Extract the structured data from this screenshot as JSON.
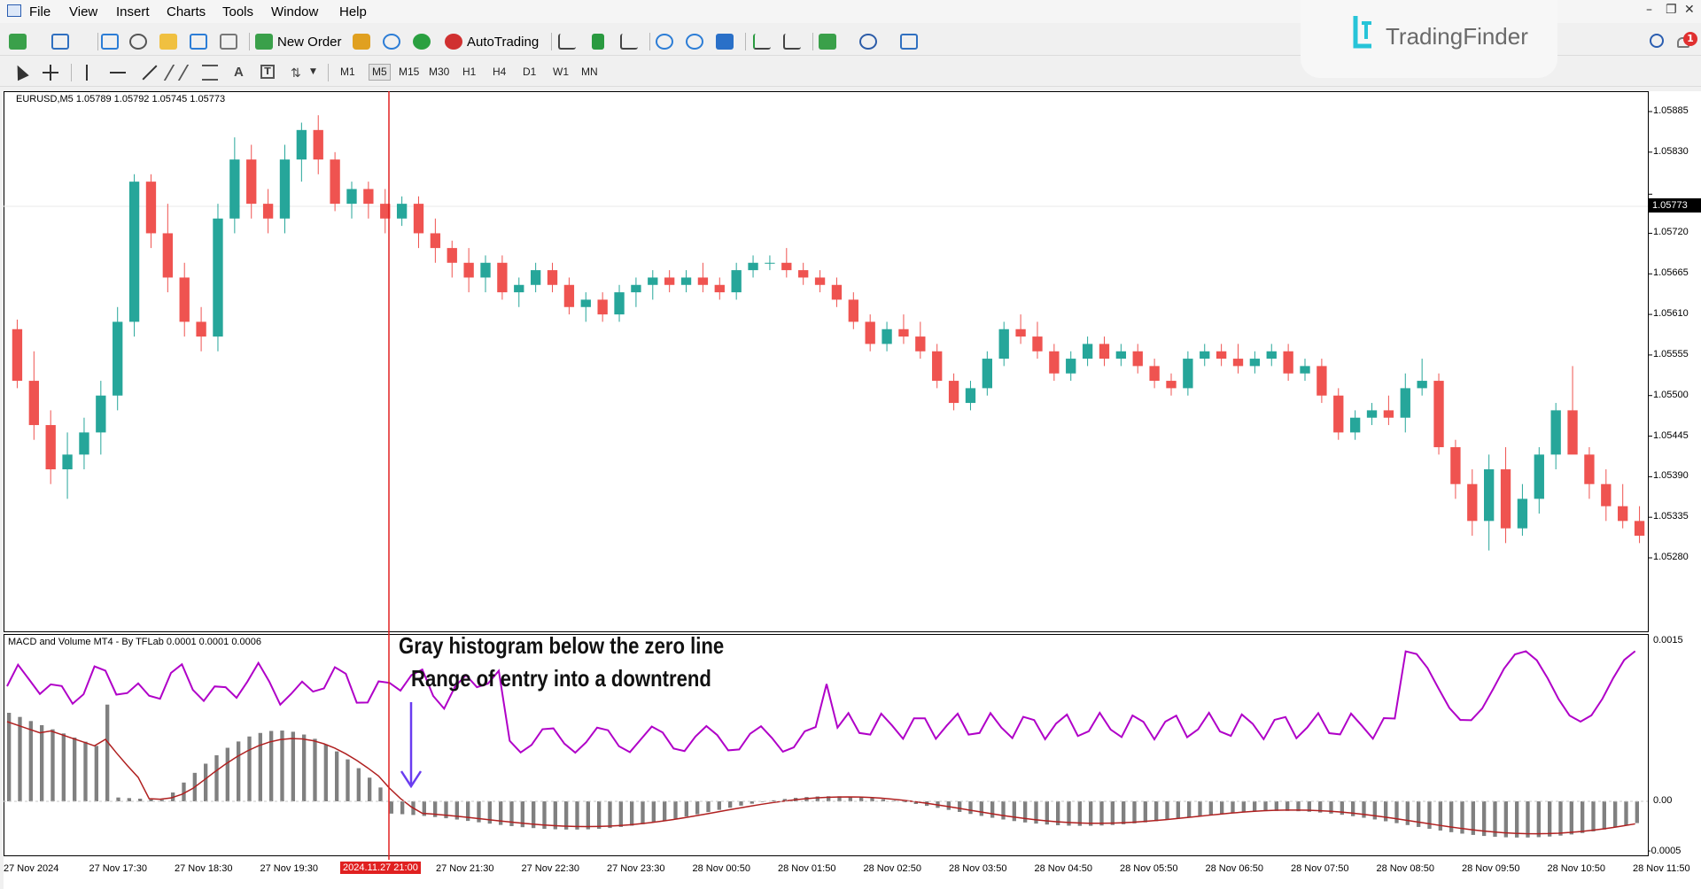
{
  "menu": [
    "File",
    "View",
    "Insert",
    "Charts",
    "Tools",
    "Window",
    "Help"
  ],
  "toolbar": {
    "new_order": "New Order",
    "autotrading": "AutoTrading"
  },
  "timeframes": [
    "M1",
    "M5",
    "M15",
    "M30",
    "H1",
    "H4",
    "D1",
    "W1",
    "MN"
  ],
  "active_timeframe": "M5",
  "logo": {
    "text": "TradingFinder"
  },
  "notification_count": "1",
  "chart": {
    "header": "EURUSD,M5  1.05789 1.05792 1.05745 1.05773",
    "price_labels": [
      "1.05885",
      "1.05830",
      "1.05773",
      "1.05720",
      "1.05665",
      "1.05610",
      "1.05555",
      "1.05500",
      "1.05445",
      "1.05390",
      "1.05335",
      "1.05280"
    ],
    "current_price": "1.05773",
    "bull_color": "#26a69a",
    "bear_color": "#ef5350",
    "line_color": "#e02020",
    "candles": [
      [
        1.0559,
        1.05603,
        1.0551,
        1.0552
      ],
      [
        1.0552,
        1.0556,
        1.0544,
        1.0546
      ],
      [
        1.0546,
        1.0548,
        1.0538,
        1.054
      ],
      [
        1.054,
        1.0545,
        1.0536,
        1.0542
      ],
      [
        1.0542,
        1.0547,
        1.054,
        1.0545
      ],
      [
        1.0545,
        1.0552,
        1.0542,
        1.055
      ],
      [
        1.055,
        1.0562,
        1.0548,
        1.056
      ],
      [
        1.056,
        1.058,
        1.0558,
        1.0579
      ],
      [
        1.0579,
        1.058,
        1.057,
        1.0572
      ],
      [
        1.0572,
        1.0576,
        1.0564,
        1.0566
      ],
      [
        1.0566,
        1.0568,
        1.0558,
        1.056
      ],
      [
        1.056,
        1.0562,
        1.0556,
        1.0558
      ],
      [
        1.0558,
        1.0576,
        1.0556,
        1.0574
      ],
      [
        1.0574,
        1.0585,
        1.0572,
        1.0582
      ],
      [
        1.0582,
        1.0584,
        1.0574,
        1.0576
      ],
      [
        1.0576,
        1.0578,
        1.0572,
        1.0574
      ],
      [
        1.0574,
        1.0584,
        1.0572,
        1.0582
      ],
      [
        1.0582,
        1.0587,
        1.0579,
        1.0586
      ],
      [
        1.0586,
        1.0588,
        1.058,
        1.0582
      ],
      [
        1.0582,
        1.0583,
        1.0575,
        1.0576
      ],
      [
        1.0576,
        1.0579,
        1.0574,
        1.0578
      ],
      [
        1.0578,
        1.0579,
        1.0574,
        1.0576
      ],
      [
        1.0576,
        1.0578,
        1.0572,
        1.0574
      ],
      [
        1.0574,
        1.0577,
        1.0573,
        1.0576
      ],
      [
        1.0576,
        1.0577,
        1.057,
        1.0572
      ],
      [
        1.0572,
        1.0574,
        1.0568,
        1.057
      ],
      [
        1.057,
        1.0571,
        1.0566,
        1.0568
      ],
      [
        1.0568,
        1.057,
        1.0564,
        1.0566
      ],
      [
        1.0566,
        1.0569,
        1.0564,
        1.0568
      ],
      [
        1.0568,
        1.0569,
        1.0563,
        1.0564
      ],
      [
        1.0564,
        1.0566,
        1.0562,
        1.0565
      ],
      [
        1.0565,
        1.0568,
        1.0564,
        1.0567
      ],
      [
        1.0567,
        1.0568,
        1.0564,
        1.0565
      ],
      [
        1.0565,
        1.0566,
        1.0561,
        1.0562
      ],
      [
        1.0562,
        1.0564,
        1.056,
        1.0563
      ],
      [
        1.0563,
        1.0564,
        1.056,
        1.0561
      ],
      [
        1.0561,
        1.0565,
        1.056,
        1.0564
      ],
      [
        1.0564,
        1.0566,
        1.0562,
        1.0565
      ],
      [
        1.0565,
        1.0567,
        1.0563,
        1.0566
      ],
      [
        1.0566,
        1.0567,
        1.0564,
        1.0565
      ],
      [
        1.0565,
        1.0567,
        1.0564,
        1.0566
      ],
      [
        1.0566,
        1.0568,
        1.0564,
        1.0565
      ],
      [
        1.0565,
        1.0566,
        1.0563,
        1.0564
      ],
      [
        1.0564,
        1.0568,
        1.0563,
        1.0567
      ],
      [
        1.0567,
        1.0569,
        1.0566,
        1.0568
      ],
      [
        1.0568,
        1.0569,
        1.0567,
        1.0568
      ],
      [
        1.0568,
        1.057,
        1.0566,
        1.0567
      ],
      [
        1.0567,
        1.0568,
        1.0565,
        1.0566
      ],
      [
        1.0566,
        1.0567,
        1.0564,
        1.0565
      ],
      [
        1.0565,
        1.0566,
        1.0562,
        1.0563
      ],
      [
        1.0563,
        1.0564,
        1.0559,
        1.056
      ],
      [
        1.056,
        1.0561,
        1.0556,
        1.0557
      ],
      [
        1.0557,
        1.056,
        1.0556,
        1.0559
      ],
      [
        1.0559,
        1.0561,
        1.0557,
        1.0558
      ],
      [
        1.0558,
        1.056,
        1.0555,
        1.0556
      ],
      [
        1.0556,
        1.0557,
        1.0551,
        1.0552
      ],
      [
        1.0552,
        1.0553,
        1.0548,
        1.0549
      ],
      [
        1.0549,
        1.0552,
        1.0548,
        1.0551
      ],
      [
        1.0551,
        1.0556,
        1.055,
        1.0555
      ],
      [
        1.0555,
        1.056,
        1.0554,
        1.0559
      ],
      [
        1.0559,
        1.0561,
        1.0557,
        1.0558
      ],
      [
        1.0558,
        1.056,
        1.0555,
        1.0556
      ],
      [
        1.0556,
        1.0557,
        1.0552,
        1.0553
      ],
      [
        1.0553,
        1.0556,
        1.0552,
        1.0555
      ],
      [
        1.0555,
        1.0558,
        1.0554,
        1.0557
      ],
      [
        1.0557,
        1.0558,
        1.0554,
        1.0555
      ],
      [
        1.0555,
        1.0557,
        1.0554,
        1.0556
      ],
      [
        1.0556,
        1.0557,
        1.0553,
        1.0554
      ],
      [
        1.0554,
        1.0555,
        1.0551,
        1.0552
      ],
      [
        1.0552,
        1.0553,
        1.055,
        1.0551
      ],
      [
        1.0551,
        1.0556,
        1.055,
        1.0555
      ],
      [
        1.0555,
        1.0557,
        1.0554,
        1.0556
      ],
      [
        1.0556,
        1.0557,
        1.0554,
        1.0555
      ],
      [
        1.0555,
        1.0557,
        1.0553,
        1.0554
      ],
      [
        1.0554,
        1.0556,
        1.0553,
        1.0555
      ],
      [
        1.0555,
        1.0557,
        1.0554,
        1.0556
      ],
      [
        1.0556,
        1.0557,
        1.0552,
        1.0553
      ],
      [
        1.0553,
        1.0555,
        1.0552,
        1.0554
      ],
      [
        1.0554,
        1.0555,
        1.0549,
        1.055
      ],
      [
        1.055,
        1.0551,
        1.0544,
        1.0545
      ],
      [
        1.0545,
        1.0548,
        1.0544,
        1.0547
      ],
      [
        1.0547,
        1.0549,
        1.0546,
        1.0548
      ],
      [
        1.0548,
        1.055,
        1.0546,
        1.0547
      ],
      [
        1.0547,
        1.0553,
        1.0545,
        1.0551
      ],
      [
        1.0551,
        1.0555,
        1.055,
        1.0552
      ],
      [
        1.0552,
        1.0553,
        1.0542,
        1.0543
      ],
      [
        1.0543,
        1.0544,
        1.0536,
        1.0538
      ],
      [
        1.0538,
        1.054,
        1.0531,
        1.0533
      ],
      [
        1.0533,
        1.0542,
        1.0529,
        1.054
      ],
      [
        1.054,
        1.0543,
        1.053,
        1.0532
      ],
      [
        1.0532,
        1.0538,
        1.0531,
        1.0536
      ],
      [
        1.0536,
        1.0543,
        1.0534,
        1.0542
      ],
      [
        1.0542,
        1.0549,
        1.054,
        1.0548
      ],
      [
        1.0548,
        1.0554,
        1.0546,
        1.0542
      ],
      [
        1.0542,
        1.0543,
        1.0536,
        1.0538
      ],
      [
        1.0538,
        1.054,
        1.0533,
        1.0535
      ],
      [
        1.0535,
        1.0538,
        1.0532,
        1.0533
      ],
      [
        1.0533,
        1.0535,
        1.053,
        1.0531
      ]
    ]
  },
  "indicator": {
    "header": "MACD and Volume MT4 - By TFLab 0.0001 0.0001 0.0006",
    "labels": [
      "0.0015",
      "0.00",
      "-0.0005"
    ],
    "purple_color": "#b000c8",
    "signal_color": "#b02020",
    "hist_color": "#808080"
  },
  "annotation": {
    "line1": "Gray histogram below the zero line",
    "line2": "Range of entry into a downtrend",
    "arrow_color": "#6a3cf0"
  },
  "time_axis": {
    "labels": [
      "27 Nov 2024",
      "27 Nov 17:30",
      "27 Nov 18:30",
      "27 Nov 19:30",
      "27 Nov 21:30",
      "27 Nov 22:30",
      "27 Nov 23:30",
      "28 Nov 00:50",
      "28 Nov 01:50",
      "28 Nov 02:50",
      "28 Nov 03:50",
      "28 Nov 04:50",
      "28 Nov 05:50",
      "28 Nov 06:50",
      "28 Nov 07:50",
      "28 Nov 08:50",
      "28 Nov 09:50",
      "28 Nov 10:50",
      "28 Nov 11:50"
    ],
    "cursor_label": "2024.11.27 21:00"
  }
}
